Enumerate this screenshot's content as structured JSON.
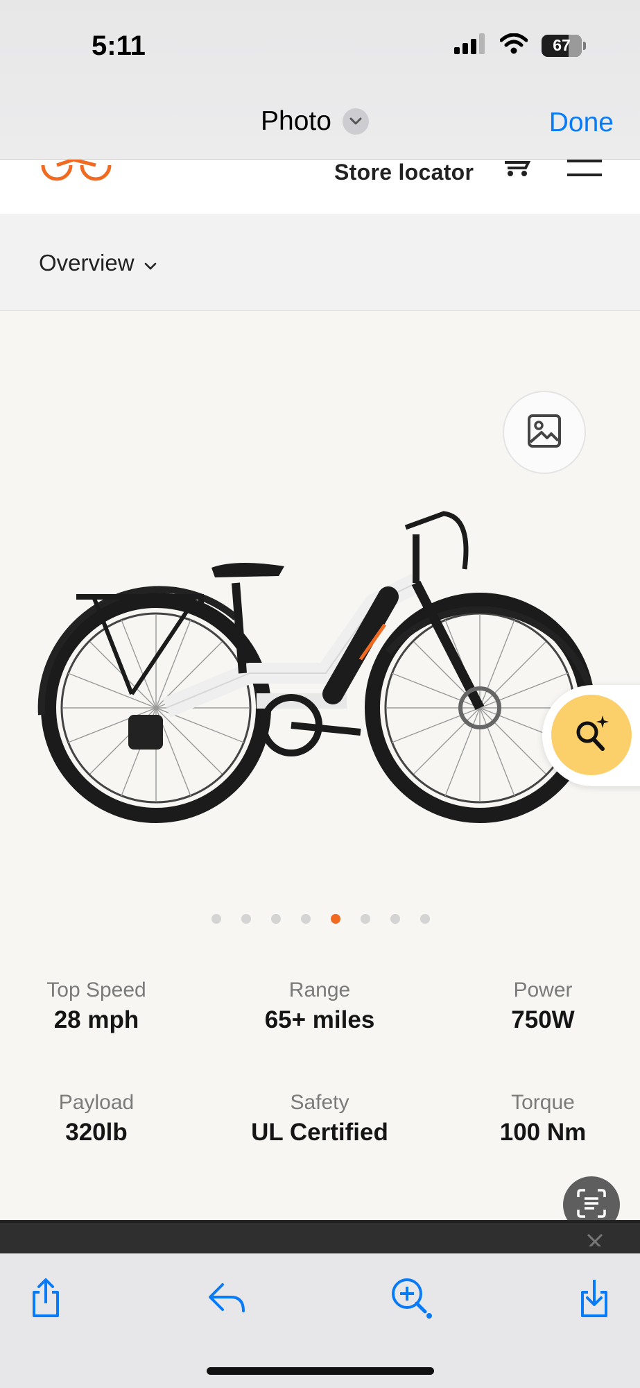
{
  "status_bar": {
    "time": "5:11",
    "battery_level": "67",
    "battery_fraction": 0.67
  },
  "header": {
    "title": "Photo",
    "done_label": "Done"
  },
  "site_nav": {
    "store_locator": "Store locator",
    "brand_color": "#f06a22"
  },
  "section_nav": {
    "label": "Overview"
  },
  "carousel": {
    "total_slides": 8,
    "active_index": 4,
    "active_color": "#f06a22"
  },
  "specs": [
    {
      "label": "Top Speed",
      "value": "28 mph"
    },
    {
      "label": "Range",
      "value": "65+ miles"
    },
    {
      "label": "Power",
      "value": "750W"
    },
    {
      "label": "Payload",
      "value": "320lb"
    },
    {
      "label": "Safety",
      "value": "UL Certified"
    },
    {
      "label": "Torque",
      "value": "100 Nm"
    }
  ],
  "icons": {
    "signal": "signal-icon",
    "wifi": "wifi-icon",
    "battery": "battery-icon",
    "chevron": "chevron-down-icon",
    "gallery": "image-icon",
    "visual_search": "magnifier-sparkle-icon",
    "live_text": "live-text-icon",
    "share": "share-icon",
    "reply": "reply-icon",
    "zoom": "zoom-in-icon",
    "download": "download-icon"
  },
  "colors": {
    "ios_blue": "#0a7bf6",
    "search_fab": "#fbd06a"
  }
}
